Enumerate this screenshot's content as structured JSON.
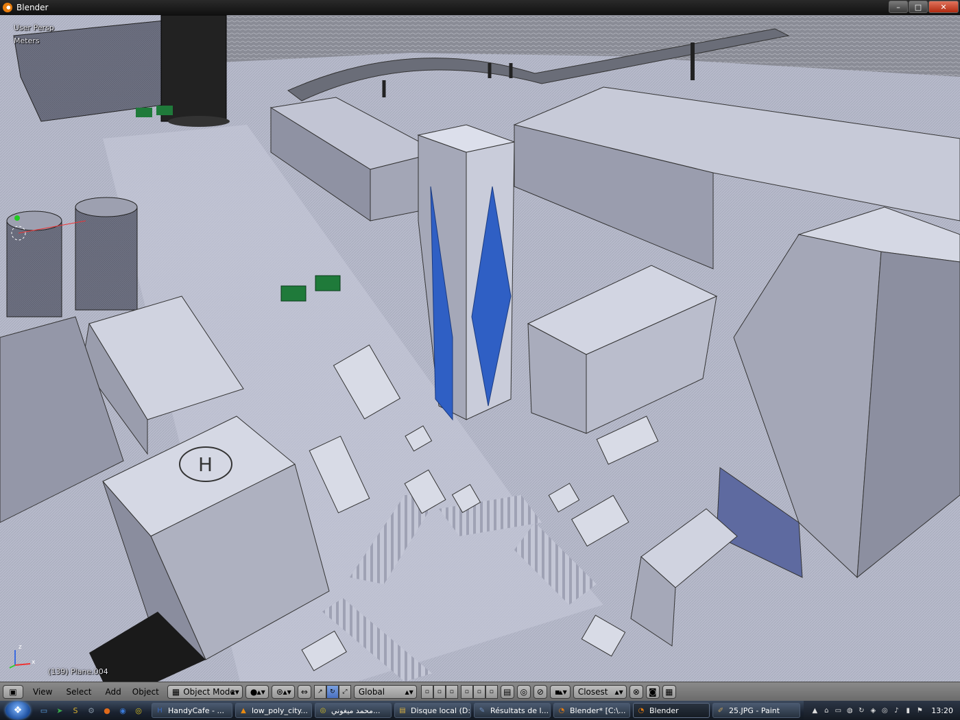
{
  "window": {
    "title": "Blender",
    "minimize_glyph": "–",
    "maximize_glyph": "□",
    "close_glyph": "✕"
  },
  "viewport": {
    "perspective_label": "User Persp",
    "units_label": "Meters",
    "object_info": "(139) Plane.004",
    "helipad_letter": "H",
    "axis_labels": {
      "z": "z",
      "x": "x"
    }
  },
  "header": {
    "editor_icon": "cube-icon",
    "menus": [
      "View",
      "Select",
      "Add",
      "Object"
    ],
    "mode": "Object Mode",
    "orientation": "Global",
    "snap_element": "Closest"
  },
  "taskbar": {
    "start_icon": "windows-logo-icon",
    "quick_launch": [
      {
        "icon": "desktop-icon",
        "glyph": "▭",
        "color": "#5aa0e0"
      },
      {
        "icon": "arrow-icon",
        "glyph": "➤",
        "color": "#3aaa4a"
      },
      {
        "icon": "sabi-icon",
        "glyph": "S",
        "color": "#d8b030"
      },
      {
        "icon": "settings-icon",
        "glyph": "⚙",
        "color": "#8090a0"
      },
      {
        "icon": "firefox-icon",
        "glyph": "●",
        "color": "#e06a1a"
      },
      {
        "icon": "browser-icon",
        "glyph": "◉",
        "color": "#3a7ad8"
      },
      {
        "icon": "chrome-icon",
        "glyph": "◎",
        "color": "#d8c020"
      }
    ],
    "tasks": [
      {
        "label": "HandyCafe - ...",
        "icon": "handycafe-icon",
        "glyph": "H",
        "color": "#3a6ac0",
        "width": 118
      },
      {
        "label": "low_poly_city...",
        "icon": "vlc-icon",
        "glyph": "▲",
        "color": "#e88a10",
        "width": 112
      },
      {
        "label": "محمد ميغوني...",
        "icon": "chrome-icon",
        "glyph": "◎",
        "color": "#d8c020",
        "width": 112
      },
      {
        "label": "Disque local (D:)",
        "icon": "folder-icon",
        "glyph": "▤",
        "color": "#d8b040",
        "width": 112
      },
      {
        "label": "Résultats de l...",
        "icon": "document-icon",
        "glyph": "✎",
        "color": "#7090c0",
        "width": 112
      },
      {
        "label": "Blender* [C:\\...",
        "icon": "blender-icon",
        "glyph": "◔",
        "color": "#e87d0d",
        "width": 112
      },
      {
        "label": "Blender",
        "icon": "blender-icon",
        "glyph": "◔",
        "color": "#e87d0d",
        "width": 112,
        "active": true
      },
      {
        "label": "25.JPG - Paint",
        "icon": "paint-icon",
        "glyph": "✐",
        "color": "#c0a060",
        "width": 128
      }
    ],
    "tray_icons": [
      "vlc-icon",
      "network-icon",
      "monitor-icon",
      "chat-icon",
      "update-icon",
      "shield-icon",
      "globe-icon",
      "volume-icon",
      "battery-icon",
      "flag-icon"
    ],
    "clock": "13:20"
  },
  "colors": {
    "glass_accent": "#2f5fc4",
    "sign_green": "#1f7a3a",
    "title_bar": "#1a1a1a",
    "header_bg": "#7c7c7c",
    "taskbar": "#1a2230"
  }
}
